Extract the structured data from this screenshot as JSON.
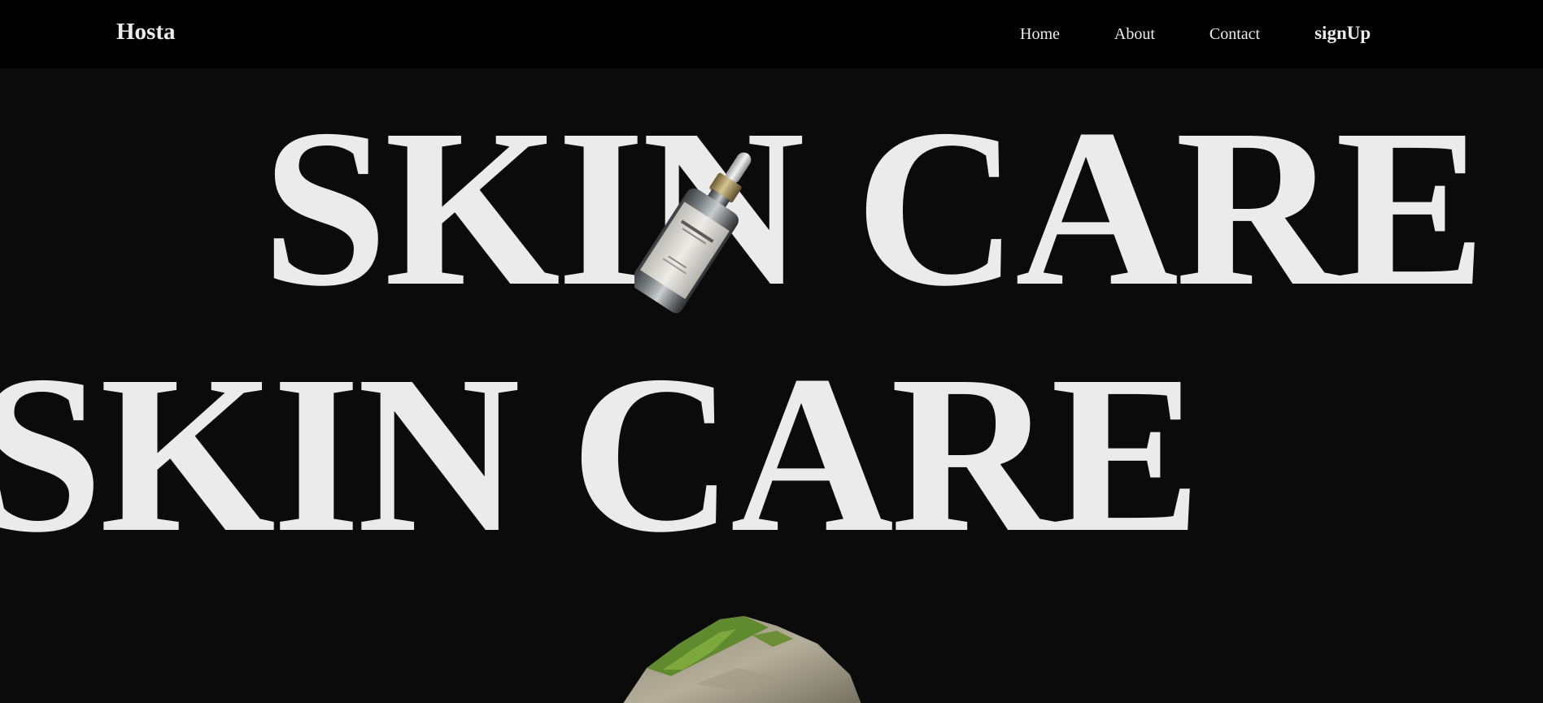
{
  "nav": {
    "brand": "Hosta",
    "links": [
      "Home",
      "About",
      "Contact"
    ],
    "signup": "signUp"
  },
  "hero": {
    "line1": "SKIN CARE",
    "line2": "SKIN CARE",
    "product_image": "serum-dropper-bottle",
    "bottom_image": "mossy-rock"
  },
  "colors": {
    "background": "#0b0b0b",
    "navbar": "#000000",
    "text": "#ebebeb"
  }
}
